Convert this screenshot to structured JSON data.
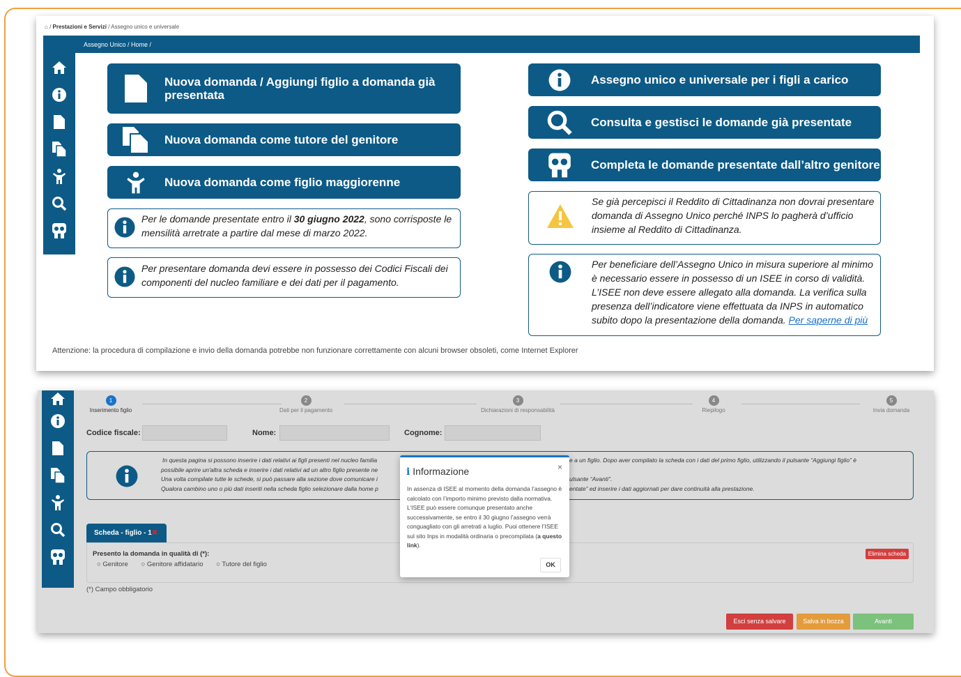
{
  "breadcrumb": {
    "home_icon": "home-icon",
    "sep1": "/",
    "item1": "Prestazioni e Servizi",
    "sep2": "/",
    "item2": "Assegno unico e universale"
  },
  "subbar": {
    "text": "Assegno Unico / Home  /"
  },
  "left_buttons": [
    {
      "label": "Nuova domanda / Aggiungi figlio a domanda già presentata",
      "icon": "document-icon"
    },
    {
      "label": "Nuova domanda come tutore del genitore",
      "icon": "documents-icon"
    },
    {
      "label": "Nuova domanda come figlio maggiorenne",
      "icon": "child-icon"
    }
  ],
  "left_info": [
    {
      "pre": "Per le domande presentate entro il ",
      "bold": "30 giugno 2022",
      "post": ", sono corrisposte le mensilità arretrate a partire dal mese di marzo 2022."
    },
    {
      "text": "Per presentare domanda devi essere in possesso dei Codici Fiscali dei componenti del nucleo familiare e dei dati per il pagamento."
    }
  ],
  "right_buttons": [
    {
      "label": "Assegno unico e universale per i figli a carico",
      "icon": "info-icon"
    },
    {
      "label": "Consulta e gestisci le domande già presentate",
      "icon": "search-icon"
    },
    {
      "label": "Completa le domande presentate dall’altro genitore",
      "icon": "family-icon"
    }
  ],
  "right_info": [
    {
      "text": "Se già percepisci il Reddito di Cittadinanza non dovrai presentare domanda di Assegno Unico perché INPS lo pagherà d’ufficio insieme al Reddito di Cittadinanza.",
      "icon": "warning-icon"
    },
    {
      "text": "Per beneficiare dell’Assegno Unico in misura superiore al minimo è necessario essere in possesso di un ISEE in corso di validità. L’ISEE non deve essere allegato alla domanda. La verifica sulla presenza dell’indicatore viene effettuata da INPS in automatico subito dopo la presentazione della domanda. ",
      "link": "Per saperne di più",
      "icon": "info-icon"
    }
  ],
  "browser_note": "Attenzione: la procedura di compilazione e invio della domanda potrebbe non funzionare correttamente con alcuni browser obsoleti, come Internet Explorer",
  "steps": [
    {
      "num": "1",
      "label": "Inserimento figlio"
    },
    {
      "num": "2",
      "label": "Dati per il pagamento"
    },
    {
      "num": "3",
      "label": "Dichiarazioni di responsabilità"
    },
    {
      "num": "4",
      "label": "Riepilogo"
    },
    {
      "num": "5",
      "label": "Invia domanda"
    }
  ],
  "form": {
    "cf_label": "Codice fiscale:",
    "name_label": "Nome:",
    "surname_label": "Cognome:"
  },
  "info_lines": [
    "In questa pagina si possono inserire i dati relativi ai figli presenti nel nucleo familia",
    "possibile aprire un'altra scheda e inserire i dati relativi ad un altro figlio presente ne",
    "Una volta compilate tutte le schede, si può passare alla sezione dove comunicare i",
    "Qualora cambino uno o più dati inseriti nella scheda figlio selezionare dalla home p"
  ],
  "info_lines_right": [
    "e a un figlio. Dopo aver compilato la scheda con i dati del primo figlio, utilizzando il pulsante “Aggiungi figlio” è",
    "",
    "ulsante “Avanti”.",
    "entate” ed inserire i dati aggiornati per dare continuità alla prestazione."
  ],
  "tab": {
    "label": "Scheda - figlio - 1",
    "close": "✖"
  },
  "card": {
    "question": "Presento la domanda in qualità di (*):",
    "options": [
      "Genitore",
      "Genitore affidatario",
      "Tutore del figlio"
    ],
    "delete": "Elimina scheda"
  },
  "required_note": "(*) Campo obbligatorio",
  "footer_buttons": {
    "exit": "Esci senza salvare",
    "draft": "Salva in bozza",
    "next": "Avanti"
  },
  "modal": {
    "title": "Informazione",
    "close": "×",
    "body": "In assenza di ISEE al momento della domanda l’assegno è calcolato con l’importo minimo previsto dalla normativa. L’ISEE può essere comunque presentato anche successivamente, se entro il 30 giugno l’assegno verrà conguagliato con gli arretrati a luglio. Puoi ottenere l’ISEE sul sito Inps in modalità ordinaria o precompilata (",
    "link": "a questo link",
    "body_end": ").",
    "ok": "OK"
  },
  "colors": {
    "brand": "#0d5a86",
    "frame": "#f0a040",
    "exit": "#d13f3f",
    "draft": "#e39b3c",
    "next": "#7cc17c"
  }
}
